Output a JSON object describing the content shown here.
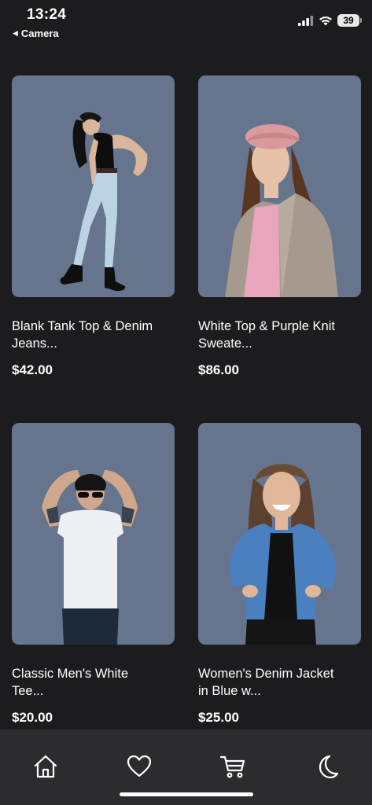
{
  "status_bar": {
    "time": "13:24",
    "back_label": "Camera",
    "battery_level": "39",
    "icons": [
      "cellular-signal-icon",
      "wifi-icon",
      "battery-icon"
    ]
  },
  "products": [
    {
      "title": "Blank Tank Top & Denim\nJeans...",
      "price": "$42.00",
      "image": "woman-in-black-tank-top-and-light-jeans-photo"
    },
    {
      "title": "White Top & Purple Knit\nSweate...",
      "price": "$86.00",
      "image": "woman-in-pink-beret-and-gray-coat-photo"
    },
    {
      "title": "Classic Men's White\nTee...",
      "price": "$20.00",
      "image": "man-in-white-tee-and-beanie-photo"
    },
    {
      "title": "Women's Denim Jacket\nin Blue w...",
      "price": "$25.00",
      "image": "woman-in-denim-jacket-photo"
    }
  ],
  "tab_bar": {
    "items": [
      "home-icon",
      "heart-icon",
      "cart-icon",
      "moon-icon"
    ]
  },
  "colors": {
    "background": "#1c1c1e",
    "card_image_background": "#66758d",
    "tab_bar_background": "#2c2c30",
    "text": "#ffffff"
  }
}
